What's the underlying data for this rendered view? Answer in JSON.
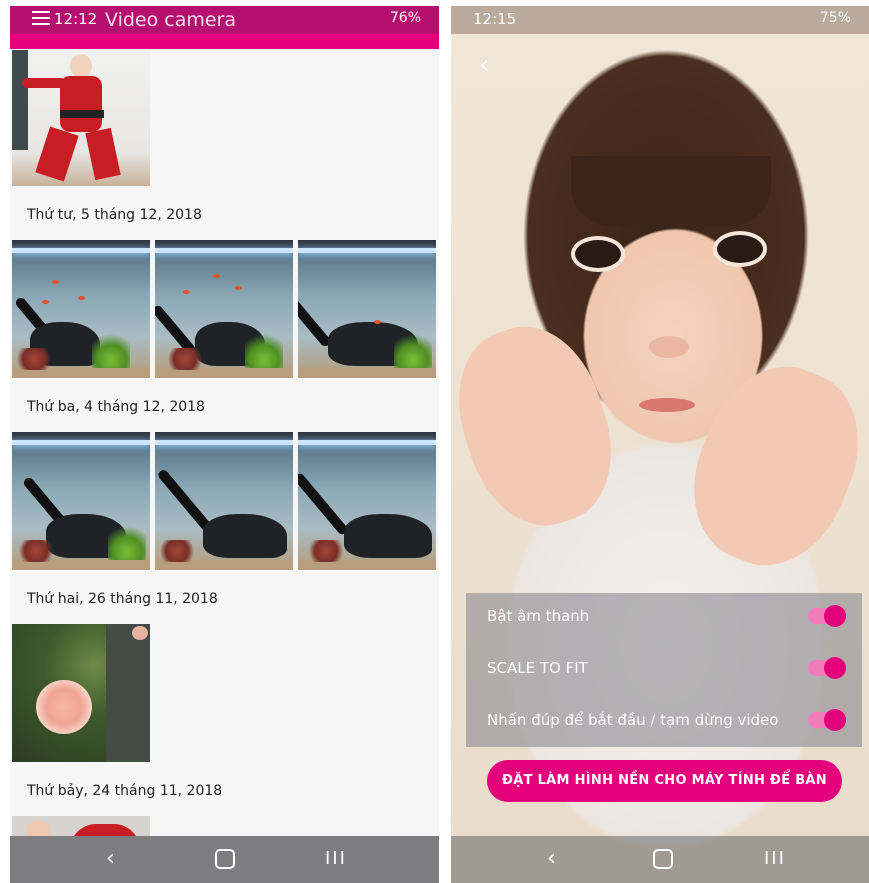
{
  "left": {
    "status": {
      "time": "12:12",
      "battery": "76%"
    },
    "title": "Video camera",
    "groups": [
      {
        "date": "Thứ tư, 5 tháng 12, 2018"
      },
      {
        "date": "Thứ ba, 4 tháng 12, 2018"
      },
      {
        "date": "Thứ hai, 26 tháng 11, 2018"
      },
      {
        "date": "Thứ bảy, 24 tháng 11, 2018"
      }
    ],
    "nav": {
      "back": "‹",
      "recent": "III"
    }
  },
  "right": {
    "status": {
      "time": "12:15",
      "battery": "75%"
    },
    "back": "‹",
    "settings": [
      {
        "label": "Bật âm thanh",
        "on": true
      },
      {
        "label": "SCALE TO FIT",
        "on": true
      },
      {
        "label": "Nhấn đúp để bắt đầu / tạm dừng video",
        "on": true
      }
    ],
    "wallpaper_button": "ĐẶT LÀM HÌNH NỀN CHO MÁY TÍNH ĐỂ BÀN",
    "nav": {
      "back": "‹",
      "recent": "III"
    }
  },
  "colors": {
    "accent": "#e4007d",
    "accent_dark": "#b5106f"
  }
}
